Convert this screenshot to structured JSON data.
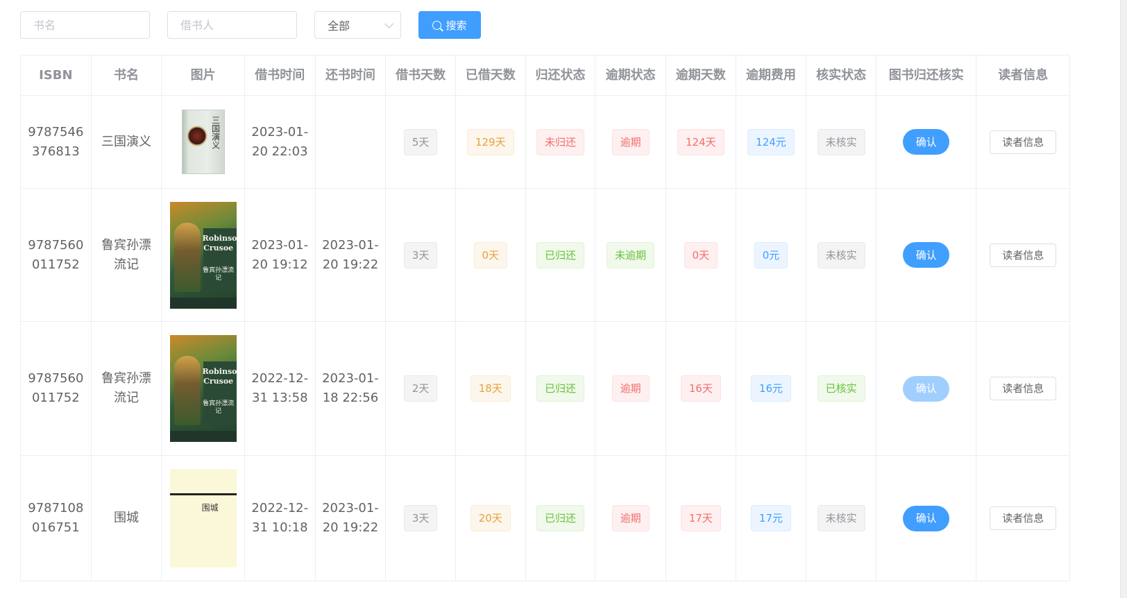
{
  "search": {
    "book_placeholder": "书名",
    "borrower_placeholder": "借书人",
    "select_value": "全部",
    "button_label": "搜索"
  },
  "table": {
    "headers": [
      "ISBN",
      "书名",
      "图片",
      "借书时间",
      "还书时间",
      "借书天数",
      "已借天数",
      "归还状态",
      "逾期状态",
      "逾期天数",
      "逾期费用",
      "核实状态",
      "图书归还核实",
      "读者信息"
    ],
    "rows": [
      {
        "isbn": "9787546376813",
        "title": "三国演义",
        "cover": "sanguo",
        "cover_text": "三国演义",
        "borrow_time": "2023-01-20 22:03",
        "return_time": "",
        "borrow_days": "5天",
        "elapsed_days": "129天",
        "return_status": "未归还",
        "overdue_status": "逾期",
        "overdue_days": "124天",
        "overdue_fee": "124元",
        "verify_status": "未核实",
        "confirm_label": "确认",
        "confirm_enabled": true,
        "reader_label": "读者信息"
      },
      {
        "isbn": "9787560011752",
        "title": "鲁宾孙漂流记",
        "cover": "robinson",
        "cover_text": "Robinson Crusoe",
        "cover_sub": "鲁宾孙漂流记",
        "borrow_time": "2023-01-20 19:12",
        "return_time": "2023-01-20 19:22",
        "borrow_days": "3天",
        "elapsed_days": "0天",
        "return_status": "已归还",
        "overdue_status": "未逾期",
        "overdue_days": "0天",
        "overdue_fee": "0元",
        "verify_status": "未核实",
        "confirm_label": "确认",
        "confirm_enabled": true,
        "reader_label": "读者信息"
      },
      {
        "isbn": "9787560011752",
        "title": "鲁宾孙漂流记",
        "cover": "robinson",
        "cover_text": "Robinson Crusoe",
        "cover_sub": "鲁宾孙漂流记",
        "borrow_time": "2022-12-31 13:58",
        "return_time": "2023-01-18 22:56",
        "borrow_days": "2天",
        "elapsed_days": "18天",
        "return_status": "已归还",
        "overdue_status": "逾期",
        "overdue_days": "16天",
        "overdue_fee": "16元",
        "verify_status": "已核实",
        "confirm_label": "确认",
        "confirm_enabled": false,
        "reader_label": "读者信息"
      },
      {
        "isbn": "9787108016751",
        "title": "围城",
        "cover": "weicheng",
        "cover_text": "围城",
        "borrow_time": "2022-12-31 10:18",
        "return_time": "2023-01-20 19:22",
        "borrow_days": "3天",
        "elapsed_days": "20天",
        "return_status": "已归还",
        "overdue_status": "逾期",
        "overdue_days": "17天",
        "overdue_fee": "17元",
        "verify_status": "未核实",
        "confirm_label": "确认",
        "confirm_enabled": true,
        "reader_label": "读者信息"
      }
    ]
  },
  "colors": {
    "primary": "#409eff",
    "warning": "#e6a23c",
    "danger": "#f56c6c",
    "success": "#67c23a",
    "info": "#909399"
  }
}
